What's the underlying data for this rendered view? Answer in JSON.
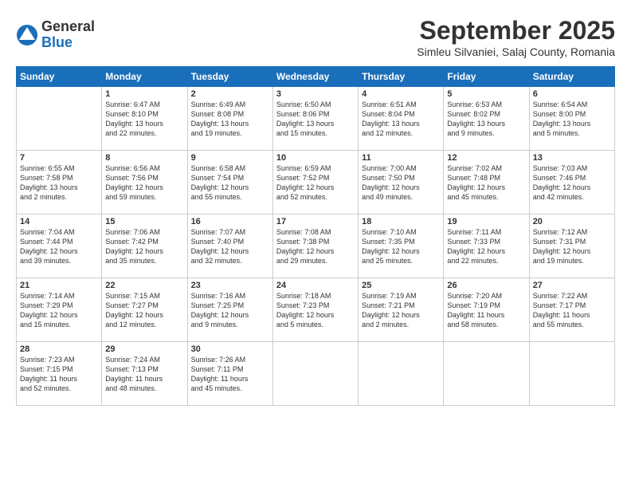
{
  "logo": {
    "general": "General",
    "blue": "Blue"
  },
  "title": "September 2025",
  "location": "Simleu Silvaniei, Salaj County, Romania",
  "days_of_week": [
    "Sunday",
    "Monday",
    "Tuesday",
    "Wednesday",
    "Thursday",
    "Friday",
    "Saturday"
  ],
  "weeks": [
    [
      {
        "day": "",
        "info": ""
      },
      {
        "day": "1",
        "info": "Sunrise: 6:47 AM\nSunset: 8:10 PM\nDaylight: 13 hours\nand 22 minutes."
      },
      {
        "day": "2",
        "info": "Sunrise: 6:49 AM\nSunset: 8:08 PM\nDaylight: 13 hours\nand 19 minutes."
      },
      {
        "day": "3",
        "info": "Sunrise: 6:50 AM\nSunset: 8:06 PM\nDaylight: 13 hours\nand 15 minutes."
      },
      {
        "day": "4",
        "info": "Sunrise: 6:51 AM\nSunset: 8:04 PM\nDaylight: 13 hours\nand 12 minutes."
      },
      {
        "day": "5",
        "info": "Sunrise: 6:53 AM\nSunset: 8:02 PM\nDaylight: 13 hours\nand 9 minutes."
      },
      {
        "day": "6",
        "info": "Sunrise: 6:54 AM\nSunset: 8:00 PM\nDaylight: 13 hours\nand 5 minutes."
      }
    ],
    [
      {
        "day": "7",
        "info": "Sunrise: 6:55 AM\nSunset: 7:58 PM\nDaylight: 13 hours\nand 2 minutes."
      },
      {
        "day": "8",
        "info": "Sunrise: 6:56 AM\nSunset: 7:56 PM\nDaylight: 12 hours\nand 59 minutes."
      },
      {
        "day": "9",
        "info": "Sunrise: 6:58 AM\nSunset: 7:54 PM\nDaylight: 12 hours\nand 55 minutes."
      },
      {
        "day": "10",
        "info": "Sunrise: 6:59 AM\nSunset: 7:52 PM\nDaylight: 12 hours\nand 52 minutes."
      },
      {
        "day": "11",
        "info": "Sunrise: 7:00 AM\nSunset: 7:50 PM\nDaylight: 12 hours\nand 49 minutes."
      },
      {
        "day": "12",
        "info": "Sunrise: 7:02 AM\nSunset: 7:48 PM\nDaylight: 12 hours\nand 45 minutes."
      },
      {
        "day": "13",
        "info": "Sunrise: 7:03 AM\nSunset: 7:46 PM\nDaylight: 12 hours\nand 42 minutes."
      }
    ],
    [
      {
        "day": "14",
        "info": "Sunrise: 7:04 AM\nSunset: 7:44 PM\nDaylight: 12 hours\nand 39 minutes."
      },
      {
        "day": "15",
        "info": "Sunrise: 7:06 AM\nSunset: 7:42 PM\nDaylight: 12 hours\nand 35 minutes."
      },
      {
        "day": "16",
        "info": "Sunrise: 7:07 AM\nSunset: 7:40 PM\nDaylight: 12 hours\nand 32 minutes."
      },
      {
        "day": "17",
        "info": "Sunrise: 7:08 AM\nSunset: 7:38 PM\nDaylight: 12 hours\nand 29 minutes."
      },
      {
        "day": "18",
        "info": "Sunrise: 7:10 AM\nSunset: 7:35 PM\nDaylight: 12 hours\nand 25 minutes."
      },
      {
        "day": "19",
        "info": "Sunrise: 7:11 AM\nSunset: 7:33 PM\nDaylight: 12 hours\nand 22 minutes."
      },
      {
        "day": "20",
        "info": "Sunrise: 7:12 AM\nSunset: 7:31 PM\nDaylight: 12 hours\nand 19 minutes."
      }
    ],
    [
      {
        "day": "21",
        "info": "Sunrise: 7:14 AM\nSunset: 7:29 PM\nDaylight: 12 hours\nand 15 minutes."
      },
      {
        "day": "22",
        "info": "Sunrise: 7:15 AM\nSunset: 7:27 PM\nDaylight: 12 hours\nand 12 minutes."
      },
      {
        "day": "23",
        "info": "Sunrise: 7:16 AM\nSunset: 7:25 PM\nDaylight: 12 hours\nand 9 minutes."
      },
      {
        "day": "24",
        "info": "Sunrise: 7:18 AM\nSunset: 7:23 PM\nDaylight: 12 hours\nand 5 minutes."
      },
      {
        "day": "25",
        "info": "Sunrise: 7:19 AM\nSunset: 7:21 PM\nDaylight: 12 hours\nand 2 minutes."
      },
      {
        "day": "26",
        "info": "Sunrise: 7:20 AM\nSunset: 7:19 PM\nDaylight: 11 hours\nand 58 minutes."
      },
      {
        "day": "27",
        "info": "Sunrise: 7:22 AM\nSunset: 7:17 PM\nDaylight: 11 hours\nand 55 minutes."
      }
    ],
    [
      {
        "day": "28",
        "info": "Sunrise: 7:23 AM\nSunset: 7:15 PM\nDaylight: 11 hours\nand 52 minutes."
      },
      {
        "day": "29",
        "info": "Sunrise: 7:24 AM\nSunset: 7:13 PM\nDaylight: 11 hours\nand 48 minutes."
      },
      {
        "day": "30",
        "info": "Sunrise: 7:26 AM\nSunset: 7:11 PM\nDaylight: 11 hours\nand 45 minutes."
      },
      {
        "day": "",
        "info": ""
      },
      {
        "day": "",
        "info": ""
      },
      {
        "day": "",
        "info": ""
      },
      {
        "day": "",
        "info": ""
      }
    ]
  ]
}
